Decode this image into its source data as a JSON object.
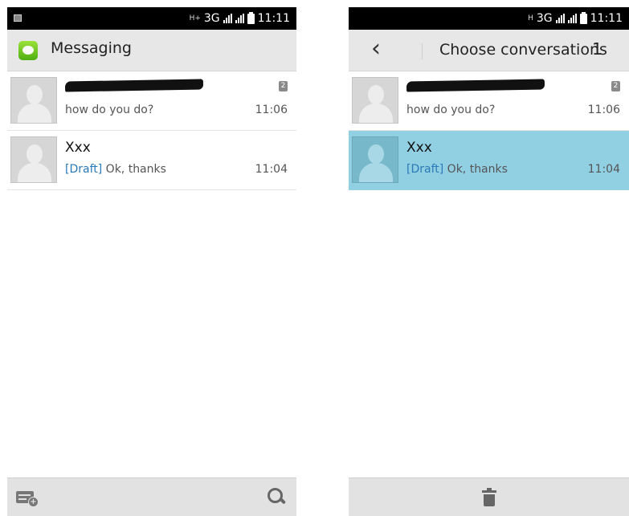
{
  "left_screen": {
    "status_bar": {
      "network": "3G",
      "sim_marker": "H+",
      "time": "11:11"
    },
    "action_bar": {
      "title": "Messaging"
    },
    "conversations": [
      {
        "name": "",
        "snippet": "how do you do?",
        "draft_prefix": "",
        "time": "11:06",
        "unread_count": "2",
        "selected": false
      },
      {
        "name": "Xxx",
        "snippet": "Ok, thanks",
        "draft_prefix": "[Draft]",
        "time": "11:04",
        "unread_count": "",
        "selected": false
      }
    ],
    "bottom_bar": {
      "left_icon": "new-message-icon",
      "right_icon": "search-icon"
    }
  },
  "right_screen": {
    "status_bar": {
      "network": "3G",
      "sim_marker": "H",
      "time": "11:11"
    },
    "action_bar": {
      "title": "Choose conversations",
      "selected_count": "1"
    },
    "conversations": [
      {
        "name": "",
        "snippet": "how do you do?",
        "draft_prefix": "",
        "time": "11:06",
        "unread_count": "2",
        "selected": false
      },
      {
        "name": "Xxx",
        "snippet": "Ok, thanks",
        "draft_prefix": "[Draft]",
        "time": "11:04",
        "unread_count": "",
        "selected": true
      }
    ],
    "bottom_bar": {
      "center_icon": "trash-icon"
    }
  },
  "colors": {
    "selection": "#91cfe3",
    "draft": "#2a7ab8",
    "action_bar": "#e7e7e7",
    "brand_green": "#6cc621"
  }
}
